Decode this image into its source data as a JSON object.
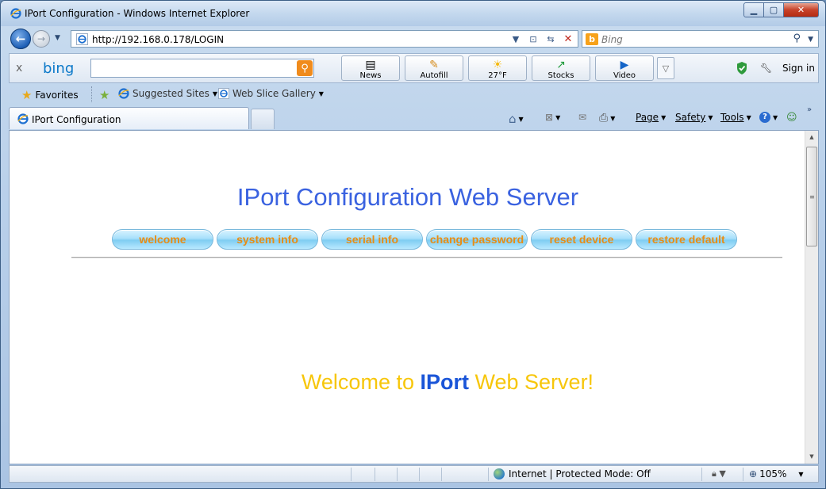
{
  "window": {
    "title": "IPort Configuration - Windows Internet Explorer",
    "minimize": "▁",
    "maximize": "▢",
    "close": "✕"
  },
  "address": {
    "url": "http://192.168.0.178/LOGIN",
    "search_placeholder": "Bing"
  },
  "bingbar": {
    "logo": "bing",
    "close": "x",
    "buttons": [
      {
        "label": "News",
        "icon": "news-icon"
      },
      {
        "label": "Autofill",
        "icon": "autofill-icon"
      },
      {
        "label": "27°F",
        "icon": "weather-sun-icon"
      },
      {
        "label": "Stocks",
        "icon": "stocks-icon"
      },
      {
        "label": "Video",
        "icon": "video-icon"
      }
    ],
    "more": "▽",
    "signin": "Sign in"
  },
  "favorites": {
    "favorites_label": "Favorites",
    "suggested_sites": "Suggested Sites",
    "web_slice_gallery": "Web Slice Gallery"
  },
  "tabs": {
    "active_label": "IPort Configuration"
  },
  "commandbar": {
    "page": "Page",
    "safety": "Safety",
    "tools": "Tools",
    "more": "»"
  },
  "content": {
    "page_title": "IPort Configuration Web Server",
    "nav": [
      "welcome",
      "system info",
      "serial info",
      "change password",
      "reset device",
      "restore default"
    ],
    "welcome_prefix": "Welcome to ",
    "welcome_brand": "IPort",
    "welcome_suffix": " Web Server!"
  },
  "status": {
    "zone": "Internet | Protected Mode: Off",
    "zoom": "105%"
  },
  "colors": {
    "title_blue": "#3a62e0",
    "pill_text": "#e88d14",
    "welcome_yellow": "#f7c60a",
    "brand_blue": "#1a55d8"
  }
}
